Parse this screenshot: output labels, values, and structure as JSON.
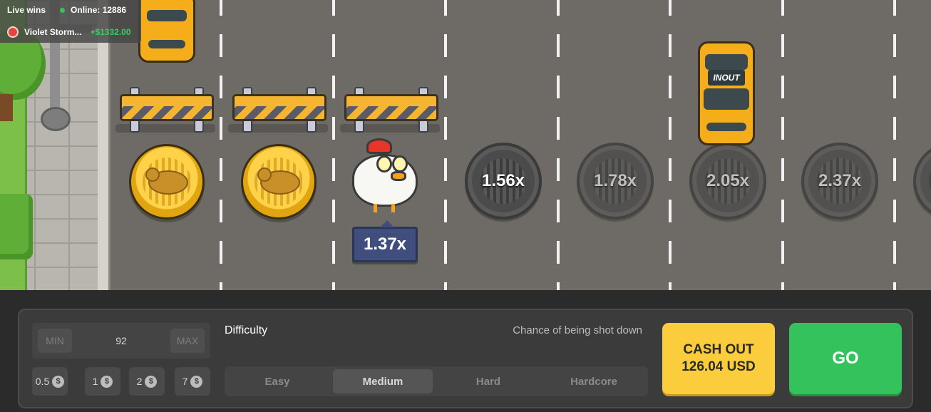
{
  "live_wins": {
    "title": "Live wins",
    "online_text": "Online: 12886",
    "latest": {
      "player": "Violet Storm...",
      "amount": "+$1332.00"
    }
  },
  "road": {
    "passed_lanes": 2,
    "chicken_multiplier": "1.37x",
    "upcoming_multipliers": [
      "1.56x",
      "1.78x",
      "2.05x",
      "2.37x"
    ],
    "car_sign": "INOUT"
  },
  "bet": {
    "min_label": "MIN",
    "amount": "92",
    "max_label": "MAX",
    "quick_bets": [
      "0.5",
      "1",
      "2",
      "7"
    ],
    "currency_symbol": "$"
  },
  "difficulty": {
    "label": "Difficulty",
    "chance_label": "Chance of being shot down",
    "options": [
      "Easy",
      "Medium",
      "Hard",
      "Hardcore"
    ],
    "selected": "Medium"
  },
  "actions": {
    "cashout_line1": "CASH OUT",
    "cashout_line2": "126.04 USD",
    "go_label": "GO"
  },
  "colors": {
    "cashout": "#fbcd3c",
    "go": "#33c25b",
    "win_green": "#36d05e",
    "multiplier_badge": "#3f4e7c"
  }
}
